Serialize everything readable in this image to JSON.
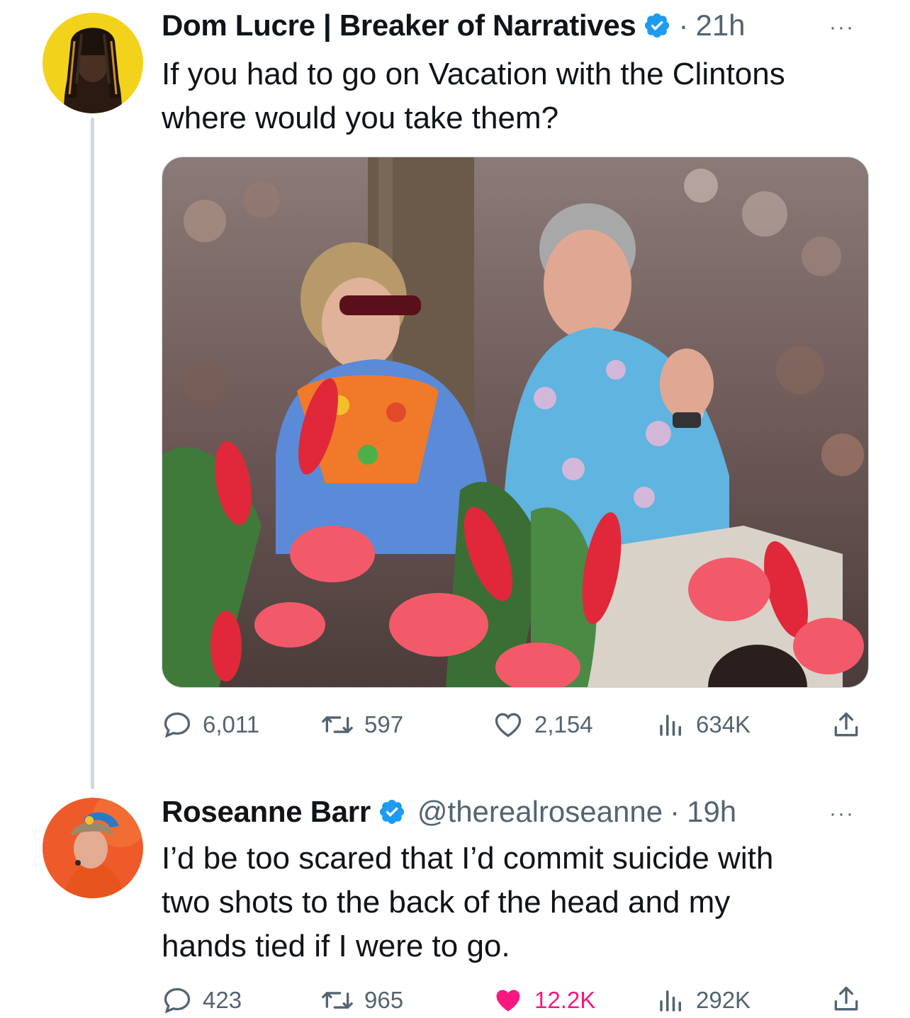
{
  "tweet1": {
    "author_name": "Dom Lucre | Breaker of Narratives",
    "time_sep": "·",
    "time": "21h",
    "more": "···",
    "text_line1": "If you had to go on Vacation with the Clintons",
    "text_line2": "where would you take them?",
    "stats": {
      "replies": "6,011",
      "retweets": "597",
      "likes": "2,154",
      "views": "634K"
    }
  },
  "tweet2": {
    "author_name": "Roseanne Barr",
    "handle": "@therealroseanne",
    "time_sep": "·",
    "time": "19h",
    "more": "···",
    "text_line1": "I’d be too scared that I’d commit suicide with",
    "text_line2": "two shots to the back of the head and my",
    "text_line3": "hands tied if I were to go.",
    "stats": {
      "replies": "423",
      "retweets": "965",
      "likes": "12.2K",
      "views": "292K"
    }
  },
  "colors": {
    "verified": "#1d9bf0",
    "secondary_text": "#536471",
    "like_active": "#f91880",
    "thread_line": "#cfd9de"
  },
  "icons": [
    "verified-badge-icon",
    "reply-icon",
    "retweet-icon",
    "like-icon",
    "views-icon",
    "share-icon",
    "more-icon"
  ]
}
